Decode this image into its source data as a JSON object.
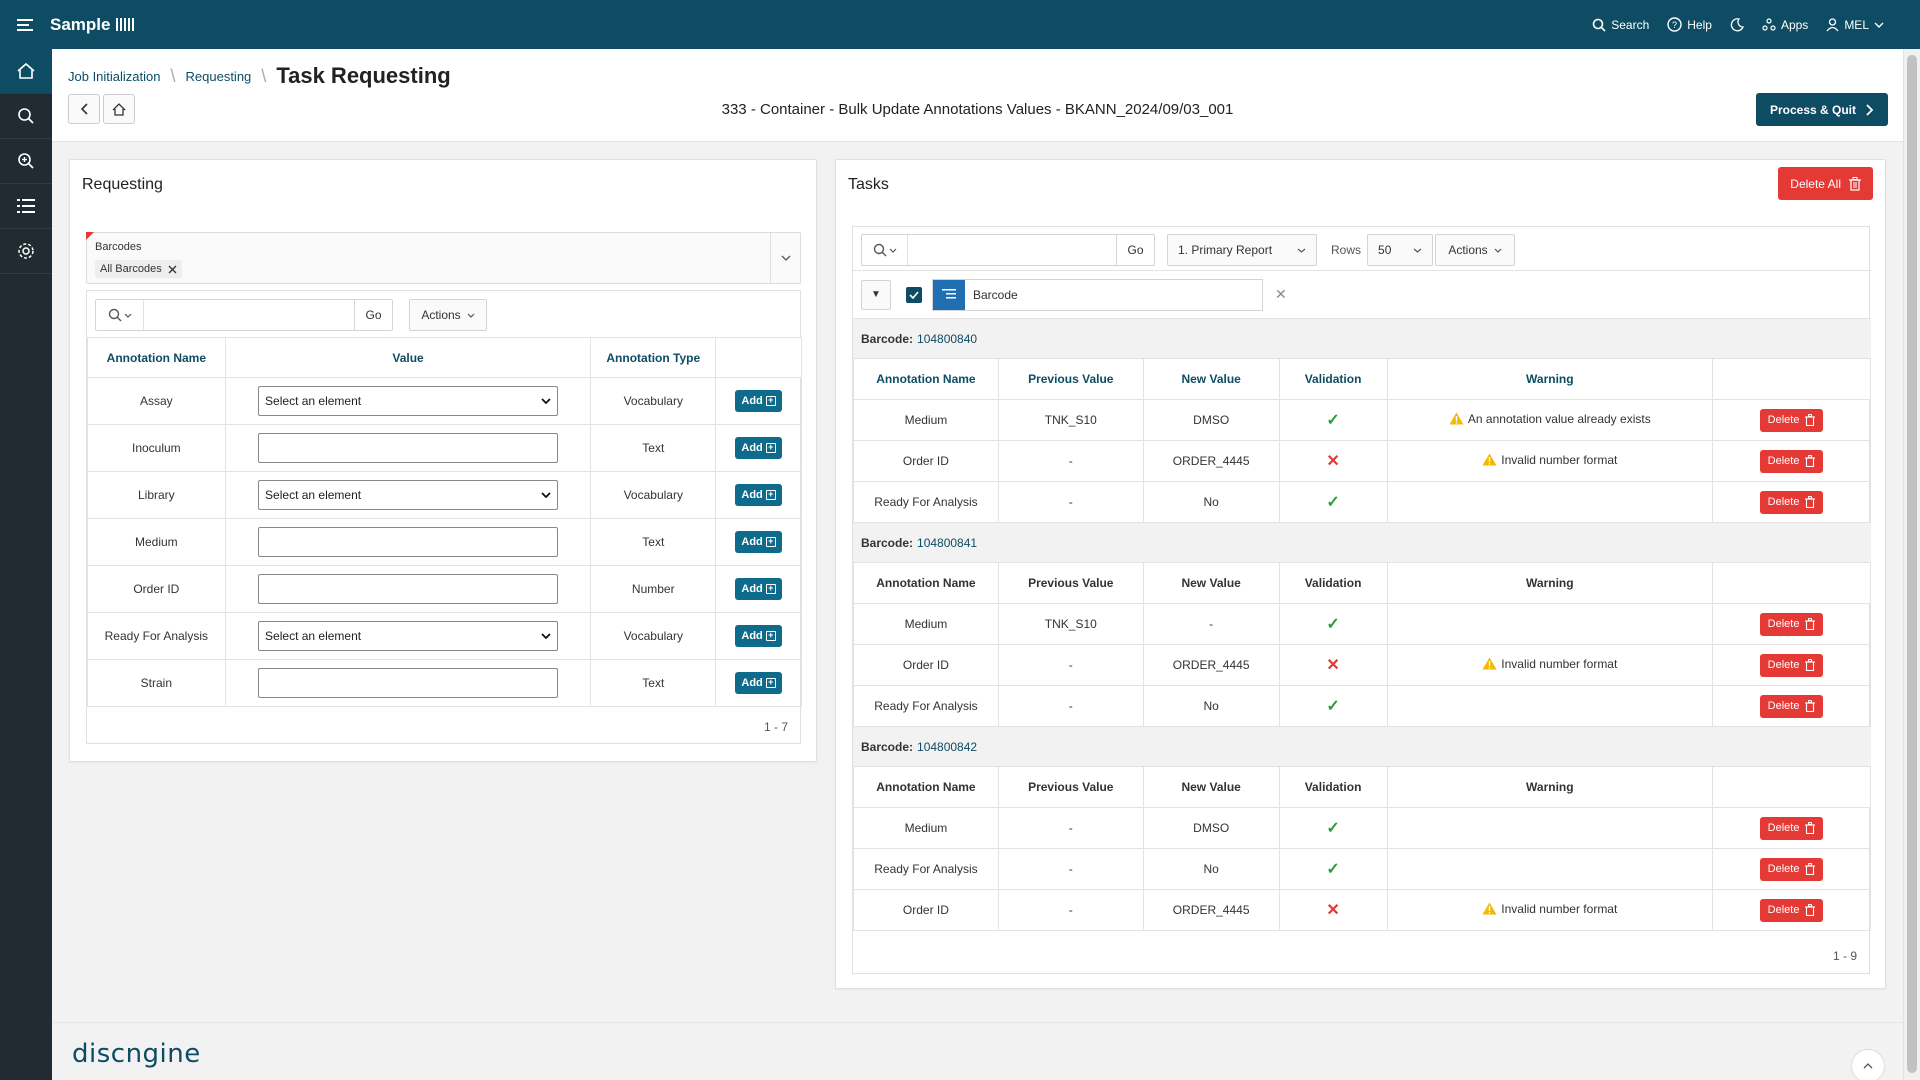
{
  "app": {
    "brand": "Sample",
    "top_links": {
      "search": "Search",
      "help": "Help",
      "apps": "Apps",
      "user": "MEL"
    }
  },
  "breadcrumb": {
    "items": [
      "Job Initialization",
      "Requesting"
    ],
    "current": "Task Requesting"
  },
  "job_title": "333 - Container - Bulk Update Annotations Values - BKANN_2024/09/03_001",
  "process_quit_label": "Process & Quit",
  "requesting": {
    "title": "Requesting",
    "barcodes_label": "Barcodes",
    "barcodes_chip": "All Barcodes",
    "go_label": "Go",
    "actions_label": "Actions",
    "columns": [
      "Annotation Name",
      "Value",
      "Annotation Type",
      ""
    ],
    "rows": [
      {
        "name": "Assay",
        "kind": "select",
        "value": "Select an element",
        "type": "Vocabulary",
        "add": "Add"
      },
      {
        "name": "Inoculum",
        "kind": "text",
        "value": "",
        "type": "Text",
        "add": "Add"
      },
      {
        "name": "Library",
        "kind": "select",
        "value": "Select an element",
        "type": "Vocabulary",
        "add": "Add"
      },
      {
        "name": "Medium",
        "kind": "text",
        "value": "",
        "type": "Text",
        "add": "Add"
      },
      {
        "name": "Order ID",
        "kind": "text",
        "value": "",
        "type": "Number",
        "add": "Add"
      },
      {
        "name": "Ready For Analysis",
        "kind": "select",
        "value": "Select an element",
        "type": "Vocabulary",
        "add": "Add"
      },
      {
        "name": "Strain",
        "kind": "text",
        "value": "",
        "type": "Text",
        "add": "Add"
      }
    ],
    "pagination": "1 - 7"
  },
  "tasks": {
    "title": "Tasks",
    "delete_all_label": "Delete All",
    "go_label": "Go",
    "report_select": "1. Primary Report",
    "rows_label": "Rows",
    "rows_value": "50",
    "actions_label": "Actions",
    "filter_label": "Barcode",
    "barcode_label": "Barcode:",
    "columns": [
      "Annotation Name",
      "Previous Value",
      "New Value",
      "Validation",
      "Warning",
      ""
    ],
    "delete_label": "Delete",
    "groups": [
      {
        "barcode": "104800840",
        "rows": [
          {
            "name": "Medium",
            "prev": "TNK_S10",
            "new": "DMSO",
            "valid": true,
            "warning": "An annotation value already exists"
          },
          {
            "name": "Order ID",
            "prev": "-",
            "new": "ORDER_4445",
            "valid": false,
            "warning": "Invalid number format"
          },
          {
            "name": "Ready For Analysis",
            "prev": "-",
            "new": "No",
            "valid": true,
            "warning": ""
          }
        ]
      },
      {
        "barcode": "104800841",
        "rows": [
          {
            "name": "Medium",
            "prev": "TNK_S10",
            "new": "-",
            "valid": true,
            "warning": ""
          },
          {
            "name": "Order ID",
            "prev": "-",
            "new": "ORDER_4445",
            "valid": false,
            "warning": "Invalid number format"
          },
          {
            "name": "Ready For Analysis",
            "prev": "-",
            "new": "No",
            "valid": true,
            "warning": ""
          }
        ]
      },
      {
        "barcode": "104800842",
        "rows": [
          {
            "name": "Medium",
            "prev": "-",
            "new": "DMSO",
            "valid": true,
            "warning": ""
          },
          {
            "name": "Ready For Analysis",
            "prev": "-",
            "new": "No",
            "valid": true,
            "warning": ""
          },
          {
            "name": "Order ID",
            "prev": "-",
            "new": "ORDER_4445",
            "valid": false,
            "warning": "Invalid number format"
          }
        ]
      }
    ],
    "pagination": "1 - 9"
  },
  "footer": {
    "logo": "discngine"
  },
  "colors": {
    "brand": "#0e4c64",
    "danger": "#e53935",
    "success": "#2e9d3c",
    "warning": "#f5b800"
  }
}
